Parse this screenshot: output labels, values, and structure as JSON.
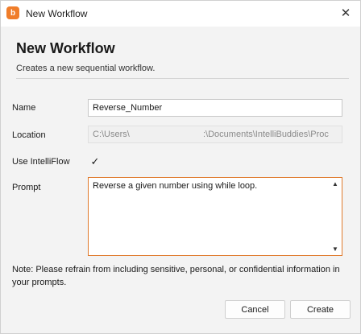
{
  "window": {
    "title": "New Workflow",
    "app_icon_glyph": "b",
    "close_glyph": "✕"
  },
  "header": {
    "title": "New Workflow",
    "subtitle": "Creates a new sequential workflow."
  },
  "form": {
    "name": {
      "label": "Name",
      "value": "Reverse_Number"
    },
    "location": {
      "label": "Location",
      "value_left": "C:\\Users\\",
      "value_right": ":\\Documents\\IntelliBuddies\\Proc"
    },
    "intelliflow": {
      "label": "Use IntelliFlow",
      "checked": true,
      "check_glyph": "✓"
    },
    "prompt": {
      "label": "Prompt",
      "value": "Reverse a given number using while loop."
    }
  },
  "scroll": {
    "up_glyph": "▲",
    "down_glyph": "▼"
  },
  "note": "Note: Please refrain from including sensitive, personal, or confidential information in your prompts.",
  "buttons": {
    "cancel": "Cancel",
    "create": "Create"
  },
  "colors": {
    "accent": "#e07a2c",
    "app_icon": "#f07d2a"
  }
}
